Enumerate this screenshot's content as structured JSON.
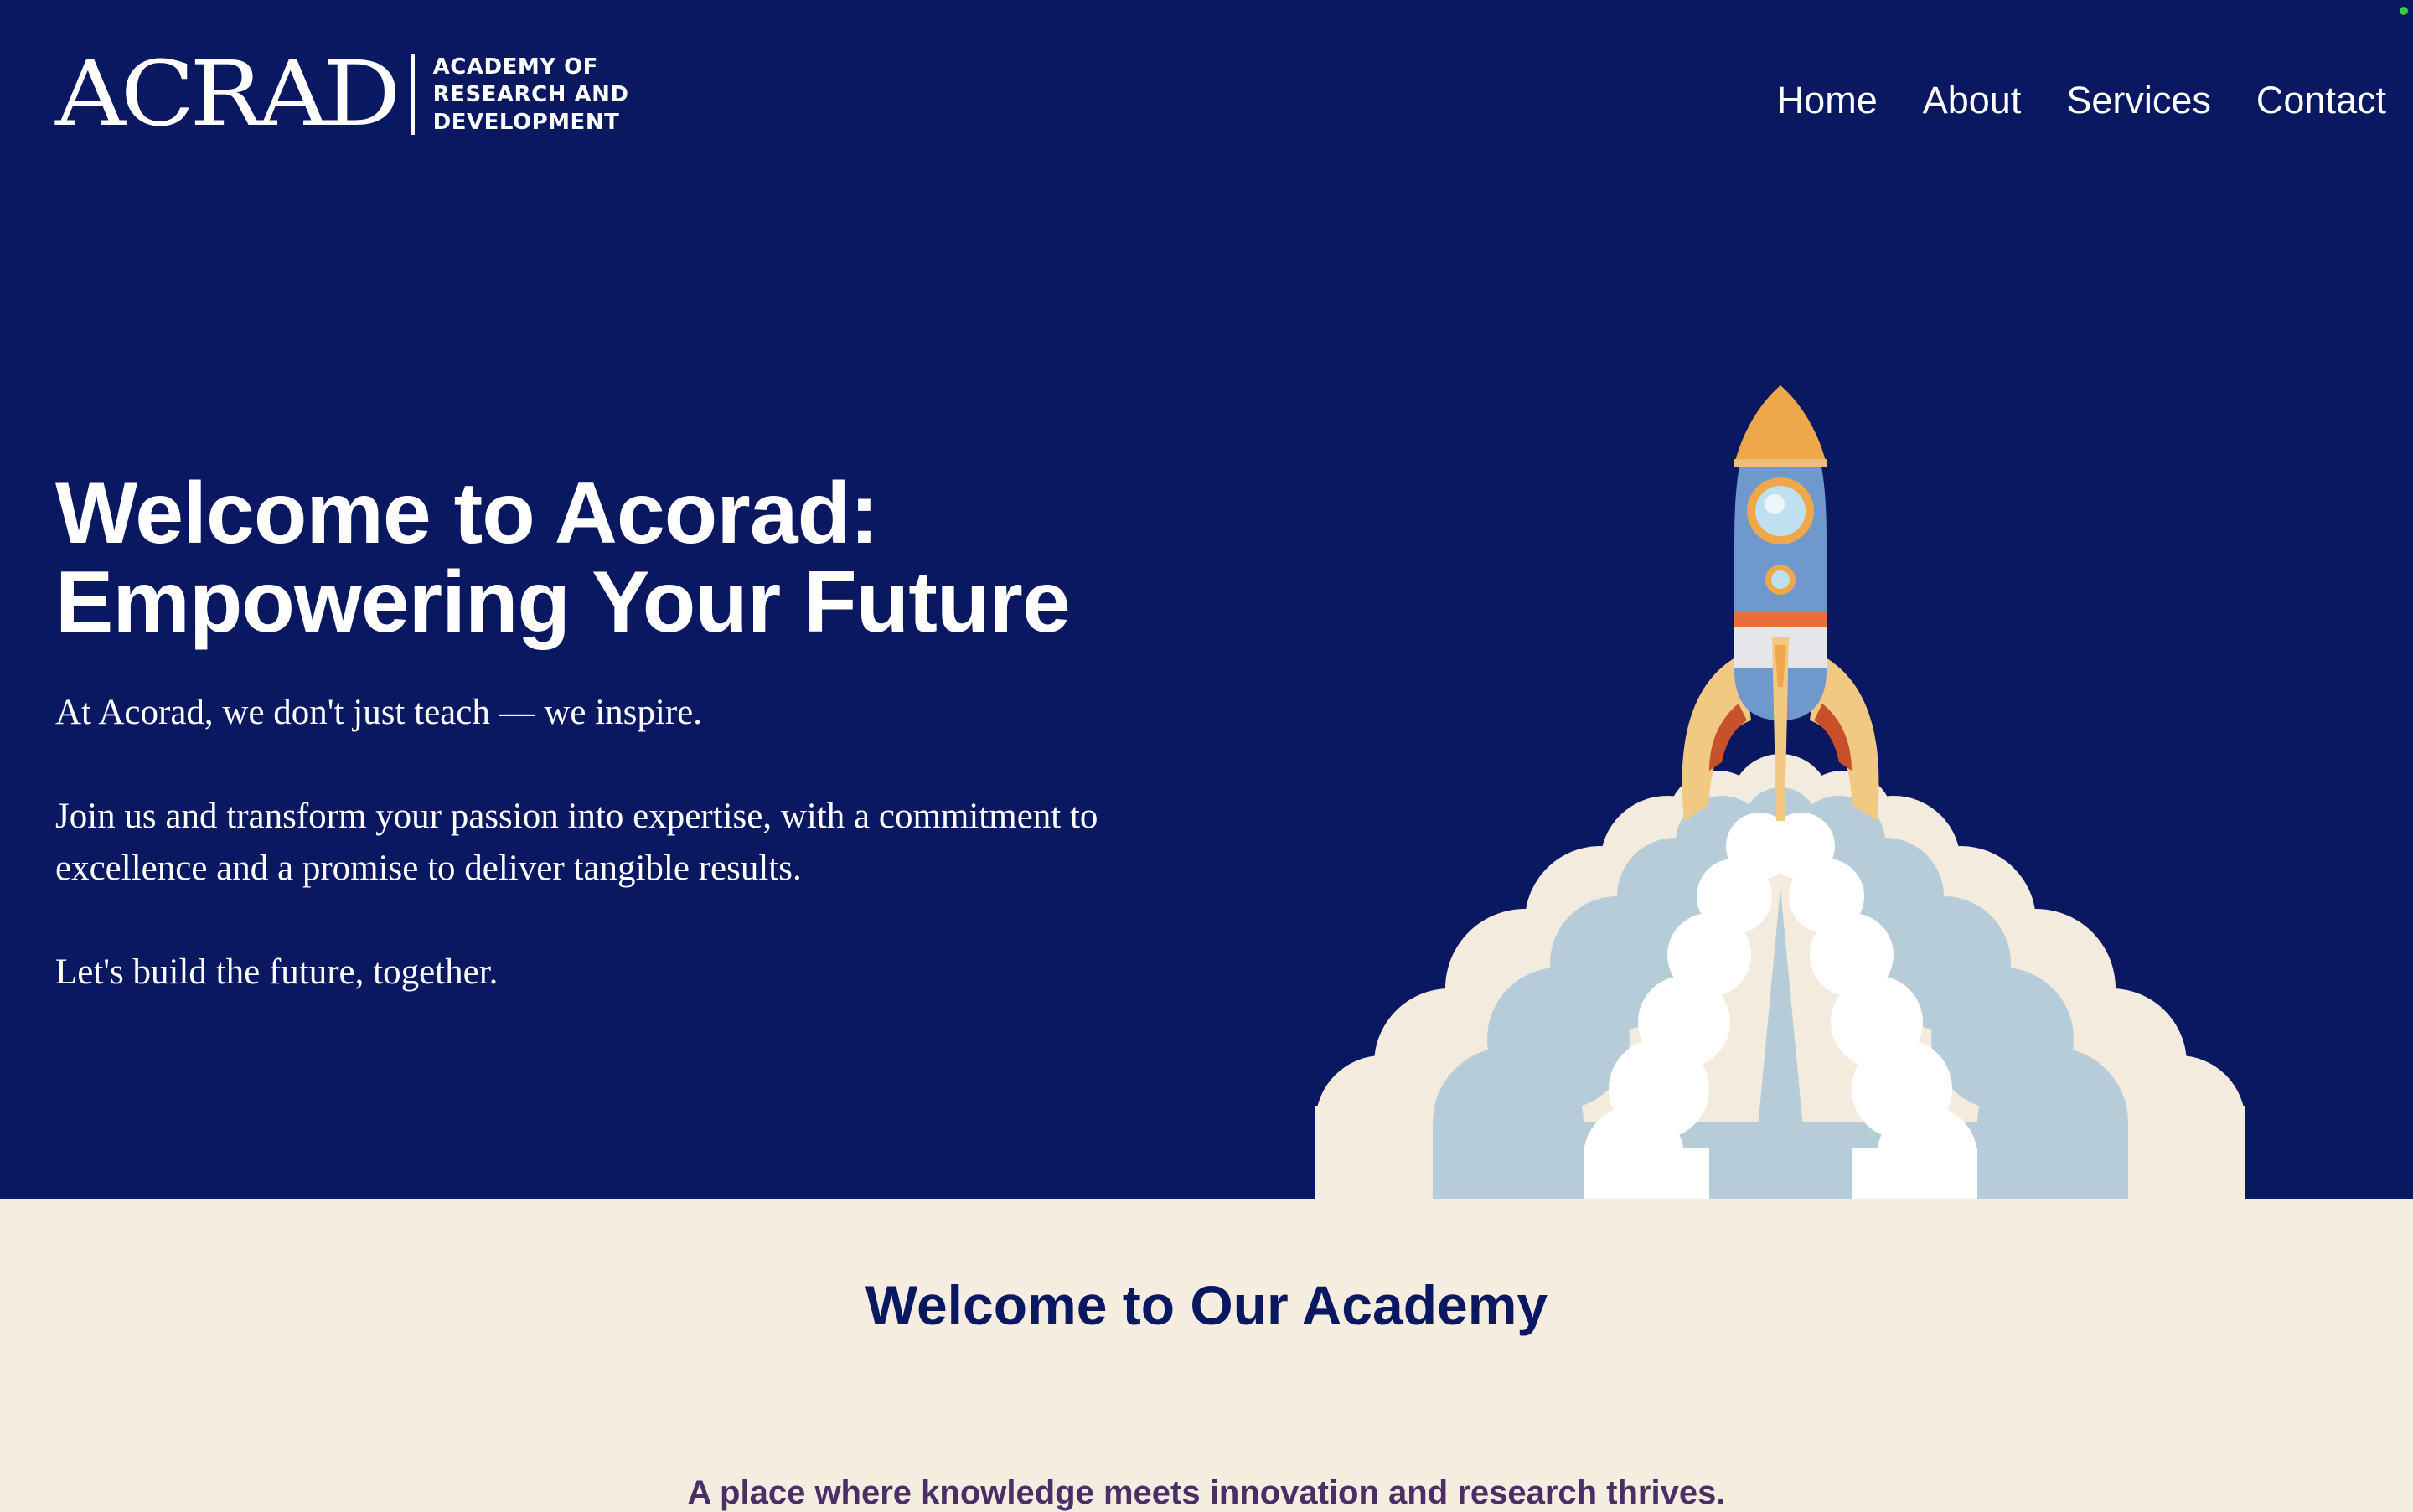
{
  "header": {
    "logo": {
      "mark": "ACRAD",
      "lines": [
        "ACADEMY OF",
        "RESEARCH AND",
        "DEVELOPMENT"
      ]
    },
    "nav": [
      "Home",
      "About",
      "Services",
      "Contact"
    ]
  },
  "hero": {
    "title_line1": "Welcome to Acorad:",
    "title_line2": "Empowering Your Future",
    "paragraphs": [
      "At Acorad, we don't just teach — we inspire.",
      "Join us and transform your passion into expertise, with a commitment to excellence and a promise to deliver tangible results.",
      "Let's build the future, together."
    ],
    "illustration_icon": "rocket-launch-icon"
  },
  "section": {
    "title": "Welcome to Our Academy",
    "subtitle": "A place where knowledge meets innovation and research thrives."
  },
  "colors": {
    "navy": "#0a1862",
    "cream": "#f5ede0",
    "white": "#ffffff",
    "subtitle_purple": "#4b2e66"
  }
}
